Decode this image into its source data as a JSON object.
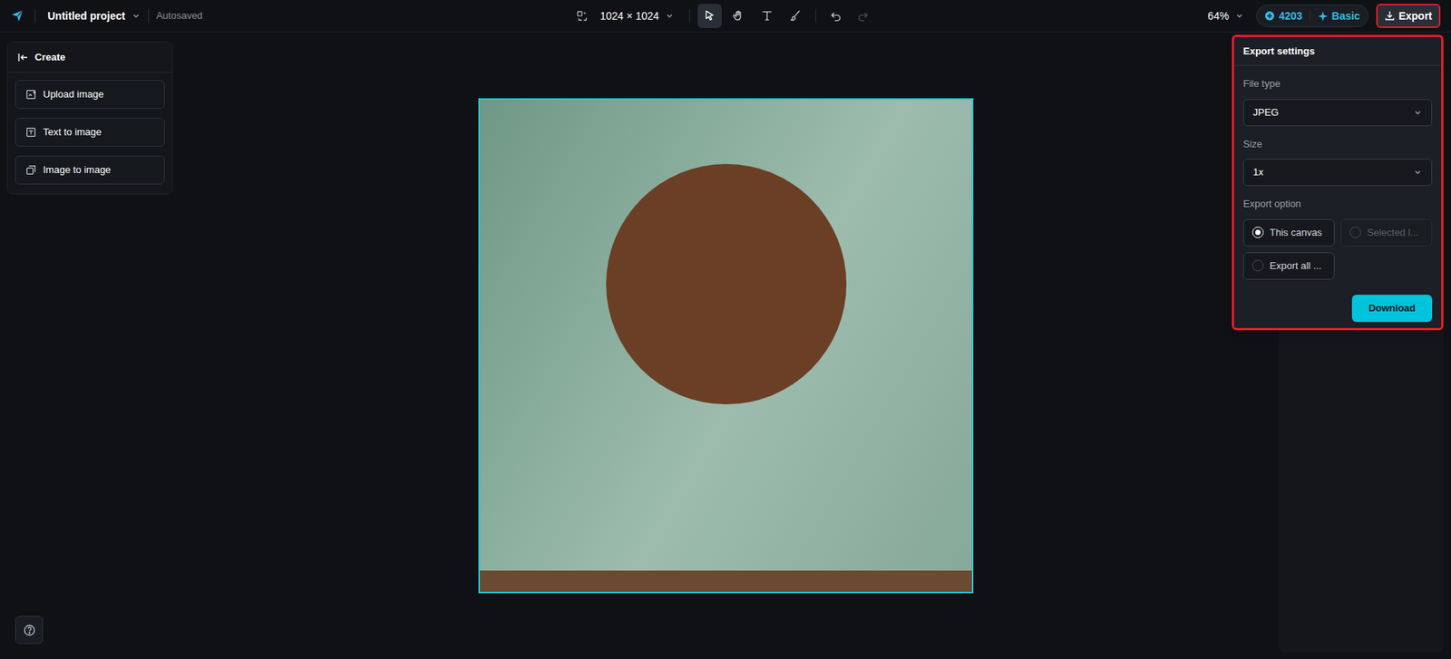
{
  "project": {
    "title": "Untitled project",
    "status": "Autosaved"
  },
  "canvas_size": "1024 × 1024",
  "tools": [
    {
      "kind": "select",
      "selected": true
    },
    {
      "kind": "hand",
      "selected": false
    },
    {
      "kind": "text",
      "selected": false
    },
    {
      "kind": "brush",
      "selected": false
    }
  ],
  "history": [
    {
      "kind": "undo",
      "disabled": false
    },
    {
      "kind": "redo",
      "disabled": true
    }
  ],
  "zoom": "64%",
  "credits": "4203",
  "plan": "Basic",
  "export_button": "Export",
  "create_panel": {
    "title": "Create",
    "items": [
      "Upload image",
      "Text to image",
      "Image to image"
    ]
  },
  "export_settings": {
    "title": "Export settings",
    "file_type": {
      "label": "File type",
      "value": "JPEG"
    },
    "size": {
      "label": "Size",
      "value": "1x"
    },
    "export_option": {
      "label": "Export option",
      "options": [
        {
          "label": "This canvas",
          "selected": true,
          "disabled": false
        },
        {
          "label": "Selected l...",
          "selected": false,
          "disabled": true
        },
        {
          "label": "Export all ...",
          "selected": false,
          "disabled": false
        }
      ]
    },
    "download": "Download"
  }
}
